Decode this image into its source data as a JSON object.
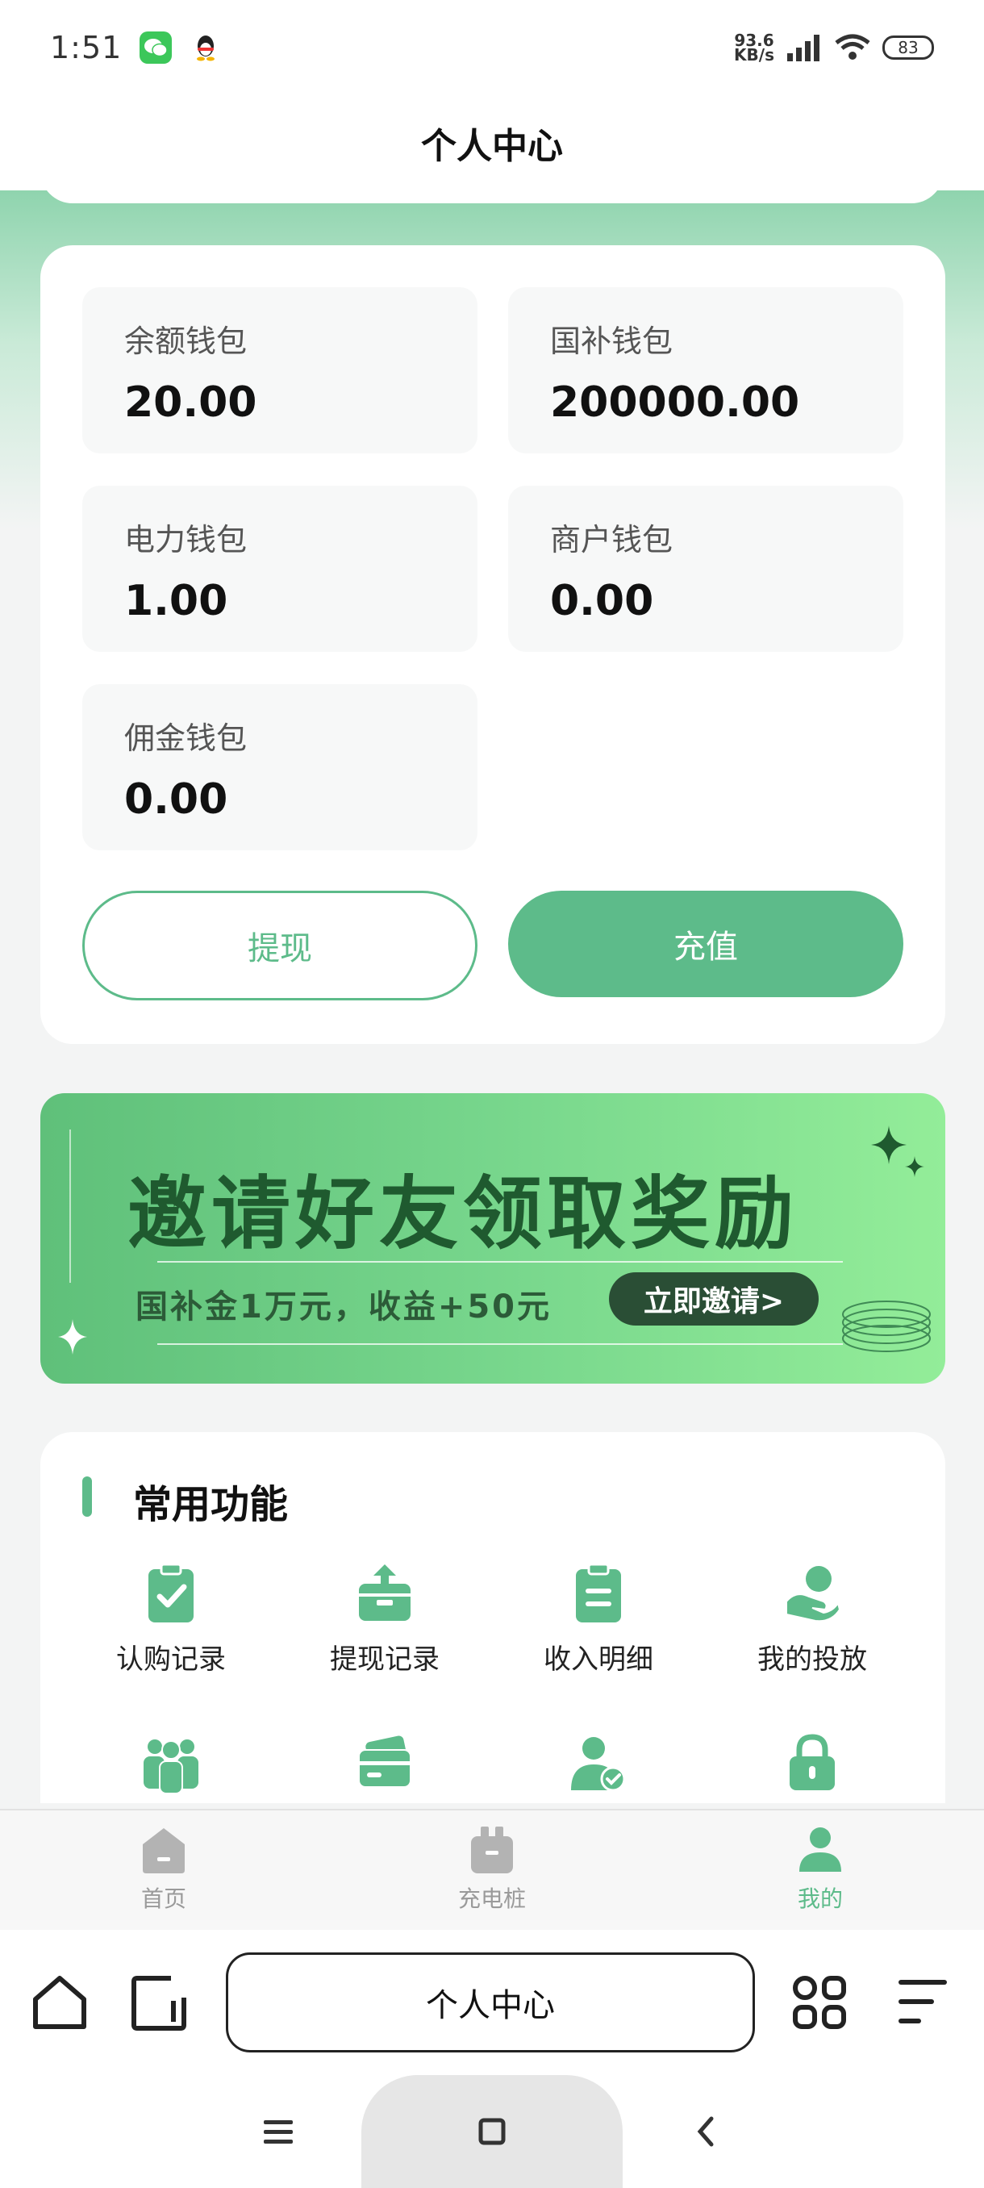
{
  "status_bar": {
    "time": "1:51",
    "net_speed_value": "93.6",
    "net_speed_unit": "KB/s",
    "battery": "83"
  },
  "header": {
    "title": "个人中心"
  },
  "wallets": [
    {
      "label": "余额钱包",
      "value": "20.00"
    },
    {
      "label": "国补钱包",
      "value": "200000.00"
    },
    {
      "label": "电力钱包",
      "value": "1.00"
    },
    {
      "label": "商户钱包",
      "value": "0.00"
    },
    {
      "label": "佣金钱包",
      "value": "0.00"
    }
  ],
  "actions": {
    "withdraw": "提现",
    "recharge": "充值"
  },
  "banner": {
    "title": "邀请好友领取奖励",
    "subtitle": "国补金1万元，收益+50元",
    "button": "立即邀请>"
  },
  "functions": {
    "title": "常用功能",
    "items": [
      {
        "label": "认购记录",
        "icon": "clipboard-check-icon"
      },
      {
        "label": "提现记录",
        "icon": "withdraw-box-icon"
      },
      {
        "label": "收入明细",
        "icon": "clipboard-list-icon"
      },
      {
        "label": "我的投放",
        "icon": "hand-coin-icon"
      },
      {
        "label": "",
        "icon": "team-icon"
      },
      {
        "label": "",
        "icon": "card-icon"
      },
      {
        "label": "",
        "icon": "user-verified-icon"
      },
      {
        "label": "",
        "icon": "lock-icon"
      }
    ]
  },
  "tab_bar": {
    "tabs": [
      {
        "label": "首页",
        "icon": "home-icon",
        "active": false
      },
      {
        "label": "充电桩",
        "icon": "charger-icon",
        "active": false
      },
      {
        "label": "我的",
        "icon": "profile-icon",
        "active": true
      }
    ]
  },
  "browser": {
    "url_text": "个人中心"
  },
  "colors": {
    "accent": "#5dbb8a",
    "banner_dark": "#1f5a2f",
    "inactive": "#9a9a9a"
  }
}
